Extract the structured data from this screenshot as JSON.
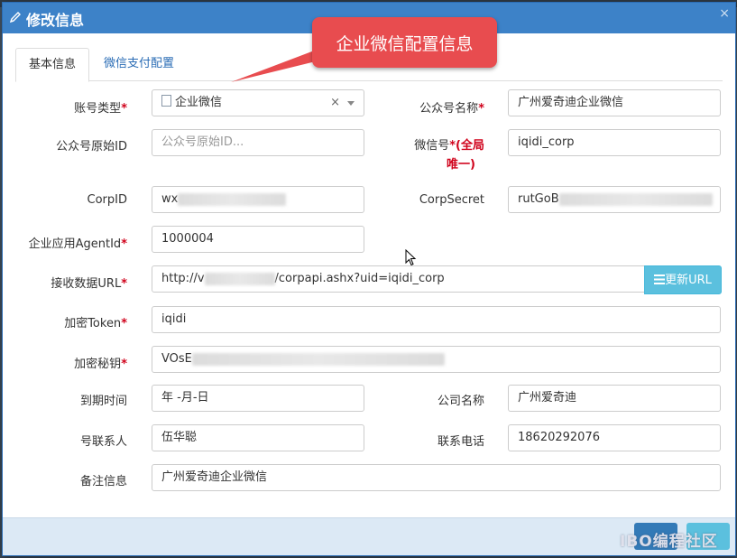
{
  "dialog": {
    "title": "修改信息",
    "close": "×"
  },
  "tabs": [
    "基本信息",
    "微信支付配置"
  ],
  "callout": "企业微信配置信息",
  "fields": {
    "account_type": {
      "label": "账号类型",
      "required": "*",
      "value": "企业微信",
      "clear": "×"
    },
    "public_name": {
      "label": "公众号名称",
      "required": "*",
      "value": "广州爱奇迪企业微信"
    },
    "original_id": {
      "label": "公众号原始ID",
      "placeholder": "公众号原始ID..."
    },
    "wechat_id": {
      "label": "微信号",
      "required": "*",
      "note": "(全局",
      "note2": "唯一)",
      "value": "iqidi_corp"
    },
    "corp_id": {
      "label": "CorpID",
      "value": "wx"
    },
    "corp_secret": {
      "label": "CorpSecret",
      "value": "rutGoB"
    },
    "agent_id": {
      "label": "企业应用AgentId",
      "required": "*",
      "value": "1000004"
    },
    "receive_url": {
      "label": "接收数据URL",
      "required": "*",
      "value_prefix": "http://v",
      "value_suffix": "/corpapi.ashx?uid=iqidi_corp",
      "button": "更新URL"
    },
    "token": {
      "label": "加密Token",
      "required": "*",
      "value": "iqidi"
    },
    "aes_key": {
      "label": "加密秘钥",
      "required": "*",
      "value": "VOsE"
    },
    "expire_date": {
      "label": "到期时间",
      "value": "年 -月-日"
    },
    "company": {
      "label": "公司名称",
      "value": "广州爱奇迪"
    },
    "contact": {
      "label": "号联系人",
      "value": "伍华聪"
    },
    "phone": {
      "label": "联系电话",
      "value": "18620292076"
    },
    "remark": {
      "label": "备注信息",
      "value": "广州爱奇迪企业微信"
    }
  },
  "footer": {
    "watermark": "IBO编程社区"
  },
  "colors": {
    "titlebar": "#3d82c8",
    "required": "#d0021b",
    "callout": "#e84c4f",
    "update_button": "#5bc0de"
  }
}
